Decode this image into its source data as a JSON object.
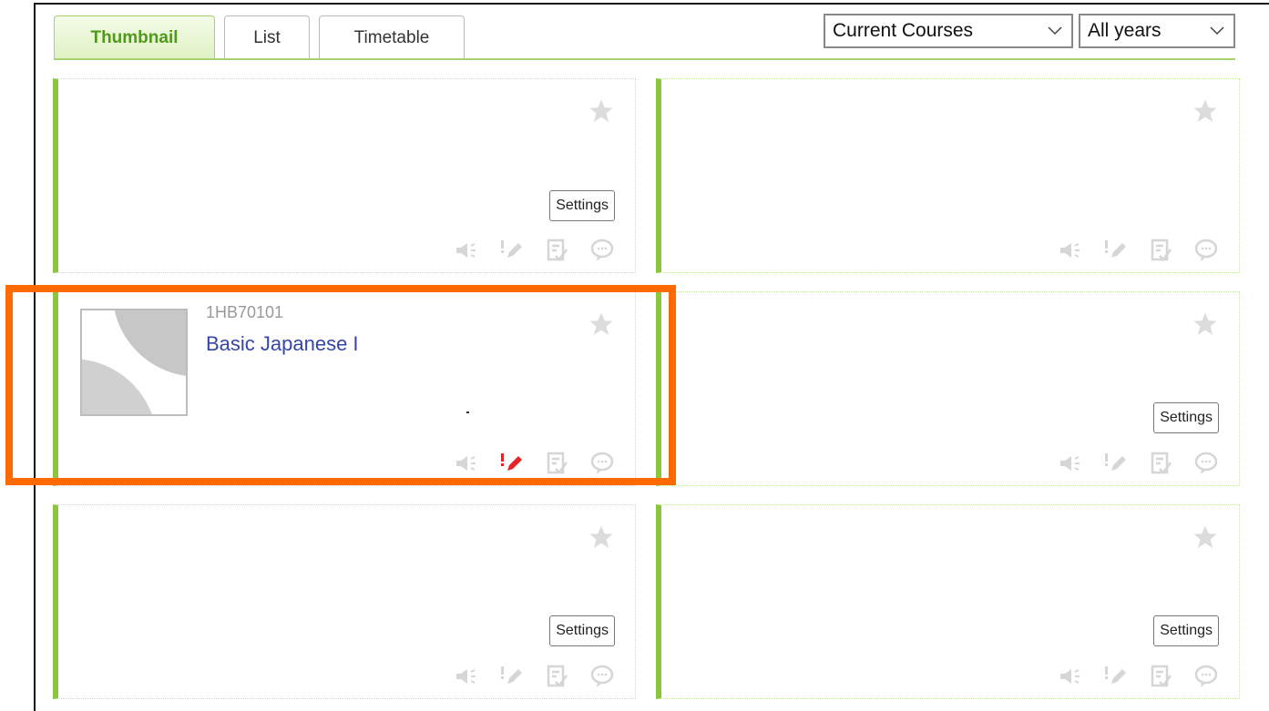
{
  "tabs": [
    {
      "label": "Thumbnail",
      "active": true
    },
    {
      "label": "List",
      "active": false
    },
    {
      "label": "Timetable",
      "active": false
    }
  ],
  "filters": {
    "course_filter": "Current Courses",
    "year_filter": "All years"
  },
  "colors": {
    "accent_green": "#8cc63f",
    "highlight_orange": "#ff6a00",
    "link_blue": "#3645a8",
    "alert_red": "#e8232a"
  },
  "cards": [
    {
      "code": "",
      "title": "",
      "settings_label": "Settings"
    },
    {
      "code": "",
      "title": "",
      "settings_label": ""
    },
    {
      "code": "1HB70101",
      "title": "Basic Japanese I",
      "settings_label": "",
      "report_alert": true
    },
    {
      "code": "",
      "title": "",
      "settings_label": "Settings"
    },
    {
      "code": "",
      "title": "",
      "settings_label": "Settings"
    },
    {
      "code": "",
      "title": "",
      "settings_label": "Settings"
    }
  ],
  "card_icons": [
    "announcement-icon",
    "report-icon",
    "test-icon",
    "forum-icon"
  ]
}
